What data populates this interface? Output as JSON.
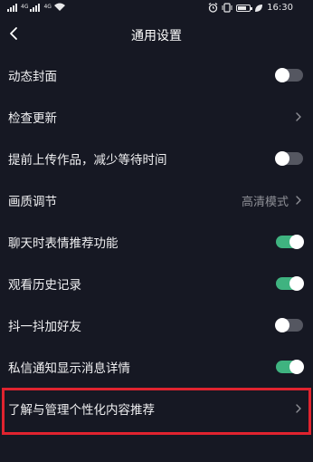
{
  "status_bar": {
    "carrier_tag_1": "4G",
    "carrier_tag_2": "4G",
    "time": "16:30"
  },
  "header": {
    "title": "通用设置"
  },
  "settings": [
    {
      "label": "动态封面",
      "control": "toggle",
      "enabled": false
    },
    {
      "label": "检查更新",
      "control": "chevron"
    },
    {
      "label": "提前上传作品，减少等待时间",
      "control": "toggle",
      "enabled": false
    },
    {
      "label": "画质调节",
      "control": "chevron",
      "value": "高清模式"
    },
    {
      "label": "聊天时表情推荐功能",
      "control": "toggle",
      "enabled": true
    },
    {
      "label": "观看历史记录",
      "control": "toggle",
      "enabled": true
    },
    {
      "label": "抖一抖加好友",
      "control": "toggle",
      "enabled": false
    },
    {
      "label": "私信通知显示消息详情",
      "control": "toggle",
      "enabled": true
    },
    {
      "label": "了解与管理个性化内容推荐",
      "control": "chevron",
      "highlighted": true
    }
  ],
  "colors": {
    "background": "#161823",
    "toggle_on": "#3fb380",
    "toggle_off": "#555761",
    "highlight_border": "#e0232f"
  }
}
